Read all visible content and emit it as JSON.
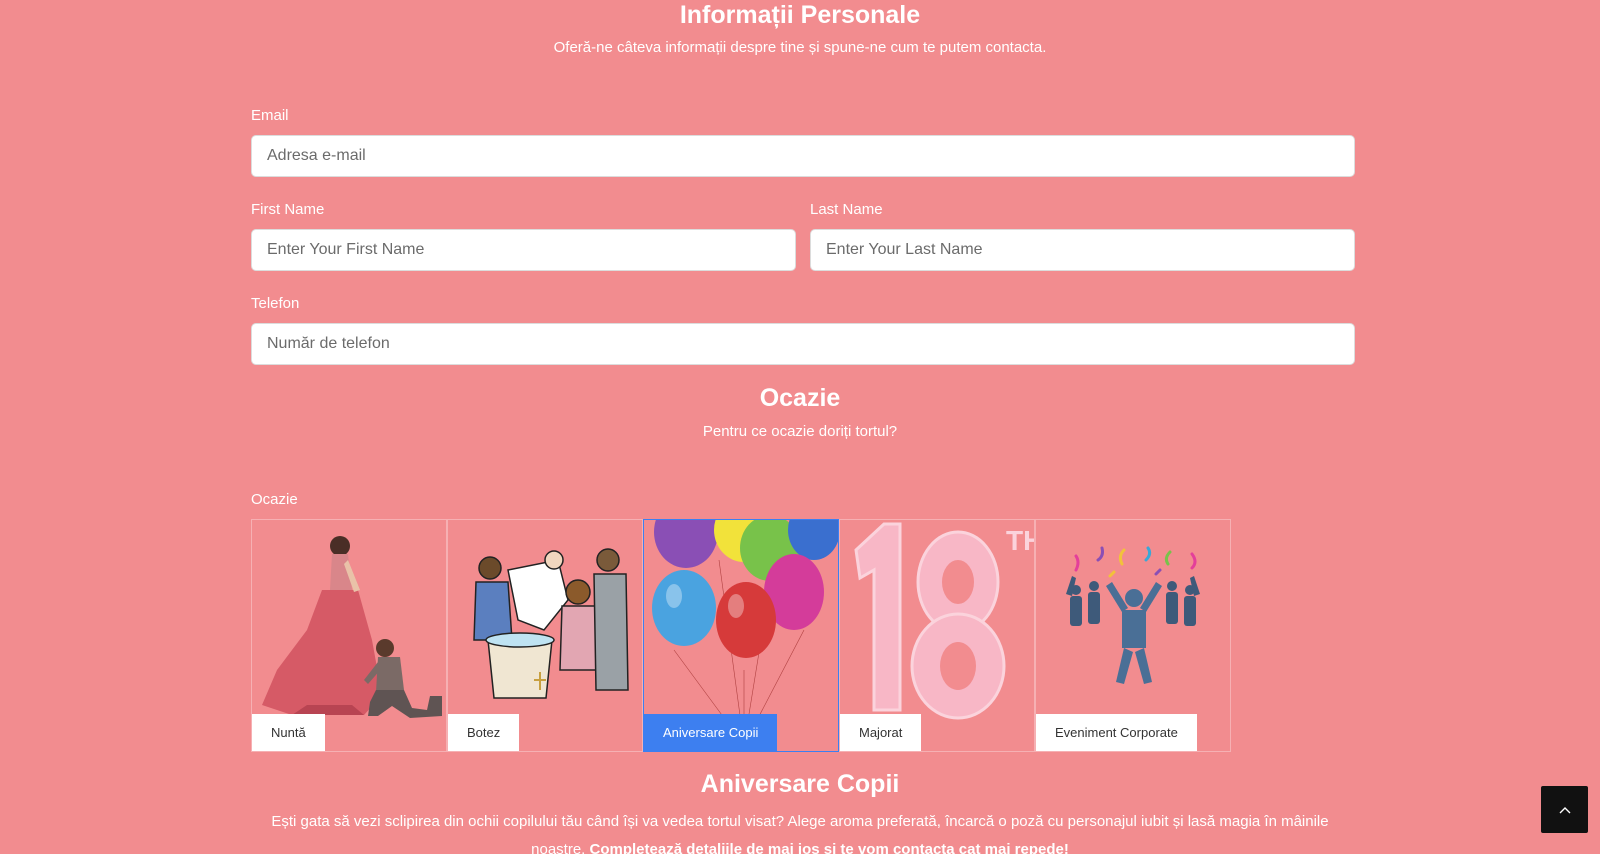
{
  "personal": {
    "title": "Informații Personale",
    "subtitle": "Oferă-ne câteva informații despre tine și spune-ne cum te putem contacta."
  },
  "form": {
    "email_label": "Email",
    "email_placeholder": "Adresa e-mail",
    "first_name_label": "First Name",
    "first_name_placeholder": "Enter Your First Name",
    "last_name_label": "Last Name",
    "last_name_placeholder": "Enter Your Last Name",
    "phone_label": "Telefon",
    "phone_placeholder": "Număr de telefon"
  },
  "occasion": {
    "title": "Ocazie",
    "subtitle": "Pentru ce ocazie doriți tortul?",
    "field_label": "Ocazie",
    "options": [
      {
        "label": "Nuntă",
        "icon": "wedding-proposal-image",
        "selected": false
      },
      {
        "label": "Botez",
        "icon": "baptism-image",
        "selected": false
      },
      {
        "label": "Aniversare Copii",
        "icon": "balloons-image",
        "selected": true
      },
      {
        "label": "Majorat",
        "icon": "balloon-18-image",
        "selected": false
      },
      {
        "label": "Eveniment Corporate",
        "icon": "corporate-celebration-image",
        "selected": false
      }
    ]
  },
  "selected_detail": {
    "title": "Aniversare Copii",
    "text": "Ești gata să vezi sclipirea din ochii copilului tău când își va vedea tortul visat? Alege aroma preferată, încarcă o poză cu personajul iubit și lasă magia în mâinile noastre.",
    "cta": "Completează detaliile de mai jos și te vom contacta cat mai repede!"
  },
  "colors": {
    "background": "#f28c8f",
    "accent": "#3d7ff0",
    "scroll_button": "#111111"
  },
  "scroll_top": {
    "icon": "chevron-up-icon"
  }
}
